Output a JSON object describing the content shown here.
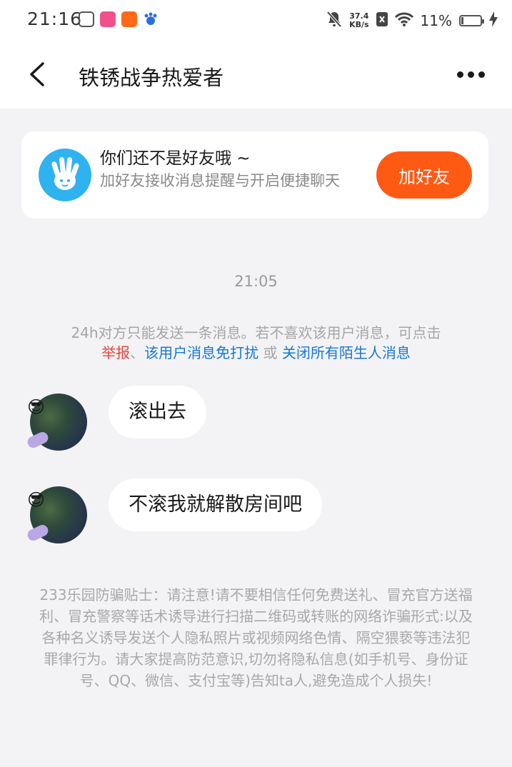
{
  "status_bar": {
    "time": "21:16",
    "network_speed": "37.4",
    "speed_unit": "KB/s",
    "battery_percent": "11%"
  },
  "header": {
    "title": "铁锈战争热爱者"
  },
  "friend_card": {
    "title": "你们还不是好友哦 ~",
    "subtitle": "加好友接收消息提醒与开启便捷聊天",
    "add_button_label": "加好友"
  },
  "chat": {
    "timestamp": "21:05",
    "notice": {
      "text_before": "24h对方只能发送一条消息。若不喜欢该用户消息，可点击",
      "report_link": "举报",
      "separator": "、",
      "mute_link": "该用户消息免打扰",
      "or_text": " 或 ",
      "close_strangers_link": "关闭所有陌生人消息"
    },
    "messages": [
      {
        "text": "滚出去"
      },
      {
        "text": "不滚我就解散房间吧"
      }
    ]
  },
  "anti_fraud_tip": "233乐园防骗贴士：请注意!请不要相信任何免费送礼、冒充官方送福利、冒充警察等话术诱导进行扫描二维码或转账的网络诈骗形式:以及各种名义诱导发送个人隐私照片或视频网络色情、隔空猥亵等违法犯罪律行为。请大家提高防范意识,切勿将隐私信息(如手机号、身份证号、QQ、微信、支付宝等)告知ta人,避免造成个人损失!",
  "colors": {
    "accent": "#ff5a14",
    "link_red": "#e8453c",
    "link_blue": "#1677d8",
    "background": "#f3f3f6"
  }
}
